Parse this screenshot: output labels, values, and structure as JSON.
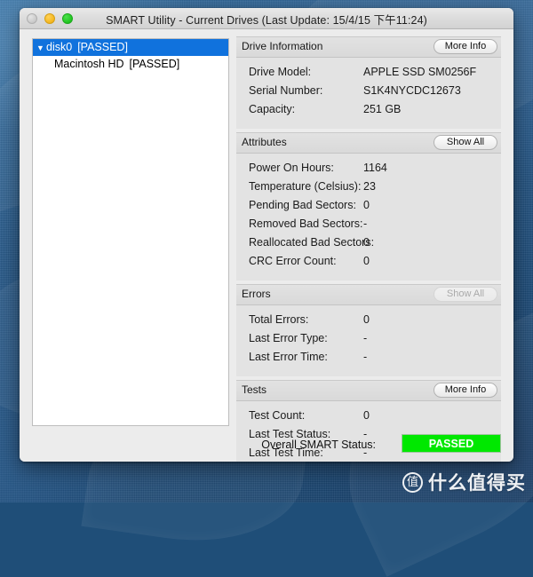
{
  "window": {
    "title": "SMART Utility - Current Drives (Last Update: 15/4/15 下午11:24)",
    "controls": {
      "close": "close-button",
      "minimize": "minimize-button",
      "maximize": "maximize-button"
    }
  },
  "sidebar": {
    "drives": [
      {
        "name": "disk0",
        "status": "[PASSED]",
        "selected": true,
        "expanded": true,
        "triangle": "▼"
      },
      {
        "name": "Macintosh HD",
        "status": "[PASSED]",
        "selected": false,
        "child": true
      }
    ]
  },
  "sections": [
    {
      "title": "Drive Information",
      "button": {
        "label": "More Info",
        "enabled": true
      },
      "rows": [
        {
          "key": "Drive Model:",
          "value": "APPLE SSD SM0256F"
        },
        {
          "key": "Serial Number:",
          "value": "S1K4NYCDC12673"
        },
        {
          "key": "Capacity:",
          "value": "251 GB"
        }
      ]
    },
    {
      "title": "Attributes",
      "button": {
        "label": "Show All",
        "enabled": true
      },
      "rows": [
        {
          "key": "Power On Hours:",
          "value": "1164"
        },
        {
          "key": "Temperature (Celsius):",
          "value": "23"
        },
        {
          "key": "Pending Bad Sectors:",
          "value": "0"
        },
        {
          "key": "Removed Bad Sectors:",
          "value": "-"
        },
        {
          "key": "Reallocated Bad Sectors:",
          "value": "0"
        },
        {
          "key": "CRC Error Count:",
          "value": "0"
        }
      ]
    },
    {
      "title": "Errors",
      "button": {
        "label": "Show All",
        "enabled": false
      },
      "rows": [
        {
          "key": "Total Errors:",
          "value": "0"
        },
        {
          "key": "Last Error Type:",
          "value": "-"
        },
        {
          "key": "Last Error Time:",
          "value": "-"
        }
      ]
    },
    {
      "title": "Tests",
      "button": {
        "label": "More Info",
        "enabled": true
      },
      "rows": [
        {
          "key": "Test Count:",
          "value": "0"
        },
        {
          "key": "Last Test Status:",
          "value": "-"
        },
        {
          "key": "Last Test Time:",
          "value": "-"
        }
      ]
    }
  ],
  "status": {
    "label": "Overall SMART Status:",
    "value": "PASSED",
    "color": "#00e800"
  },
  "watermark": {
    "logo": "值",
    "text": "什么值得买"
  }
}
